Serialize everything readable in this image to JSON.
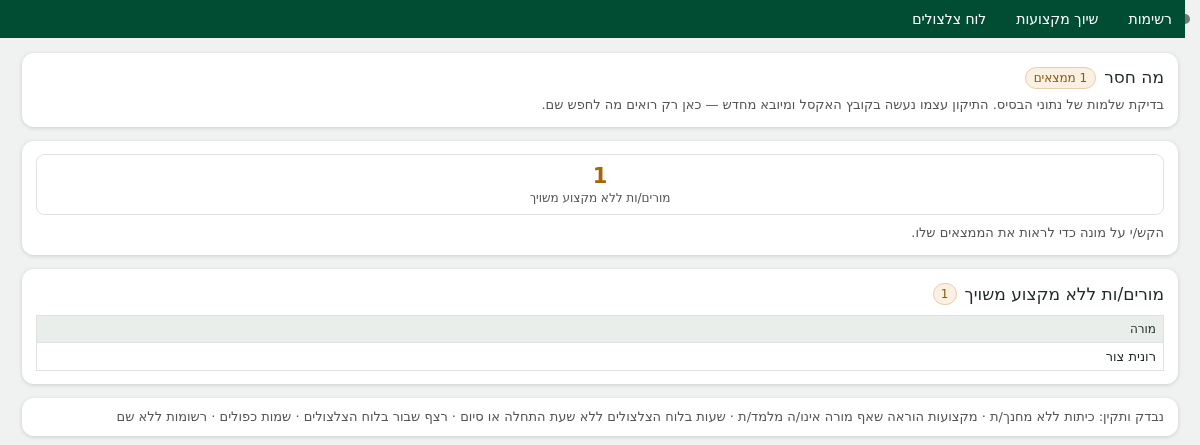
{
  "nav": {
    "tabs": [
      {
        "kind": "icon",
        "selected": true
      },
      {
        "kind": "text",
        "label": "רשימות",
        "selected": false
      },
      {
        "kind": "text",
        "label": "שיוך מקצועות",
        "selected": false
      },
      {
        "kind": "text",
        "label": "לוח צלצולים",
        "selected": false
      }
    ]
  },
  "summary": {
    "title": "מה חסר",
    "badge": "1 ממצאים",
    "description": "בדיקת שלמות של נתוני הבסיס. התיקון עצמו נעשה בקובץ האקסל ומיובא מחדש — כאן רק רואים מה לחפש שם."
  },
  "counters": {
    "items": [
      {
        "value": "1",
        "label": "מורים/ות ללא מקצוע משויך"
      }
    ],
    "hint": "הקש/י על מונה כדי לראות את הממצאים שלו."
  },
  "finding": {
    "title": "מורים/ות ללא מקצוע משויך",
    "count": "1",
    "table": {
      "columns": [
        "מורה"
      ],
      "rows": [
        [
          "רונית צור"
        ]
      ]
    }
  },
  "footer": {
    "text": "נבדק ותקין: כיתות ללא מחנך/ת · מקצועות הוראה שאף מורה אינו/ה מלמד/ת · שעות בלוח הצלצולים ללא שעת התחלה או סיום · רצף שבור בלוח הצלצולים · שמות כפולים · רשומות ללא שם"
  }
}
